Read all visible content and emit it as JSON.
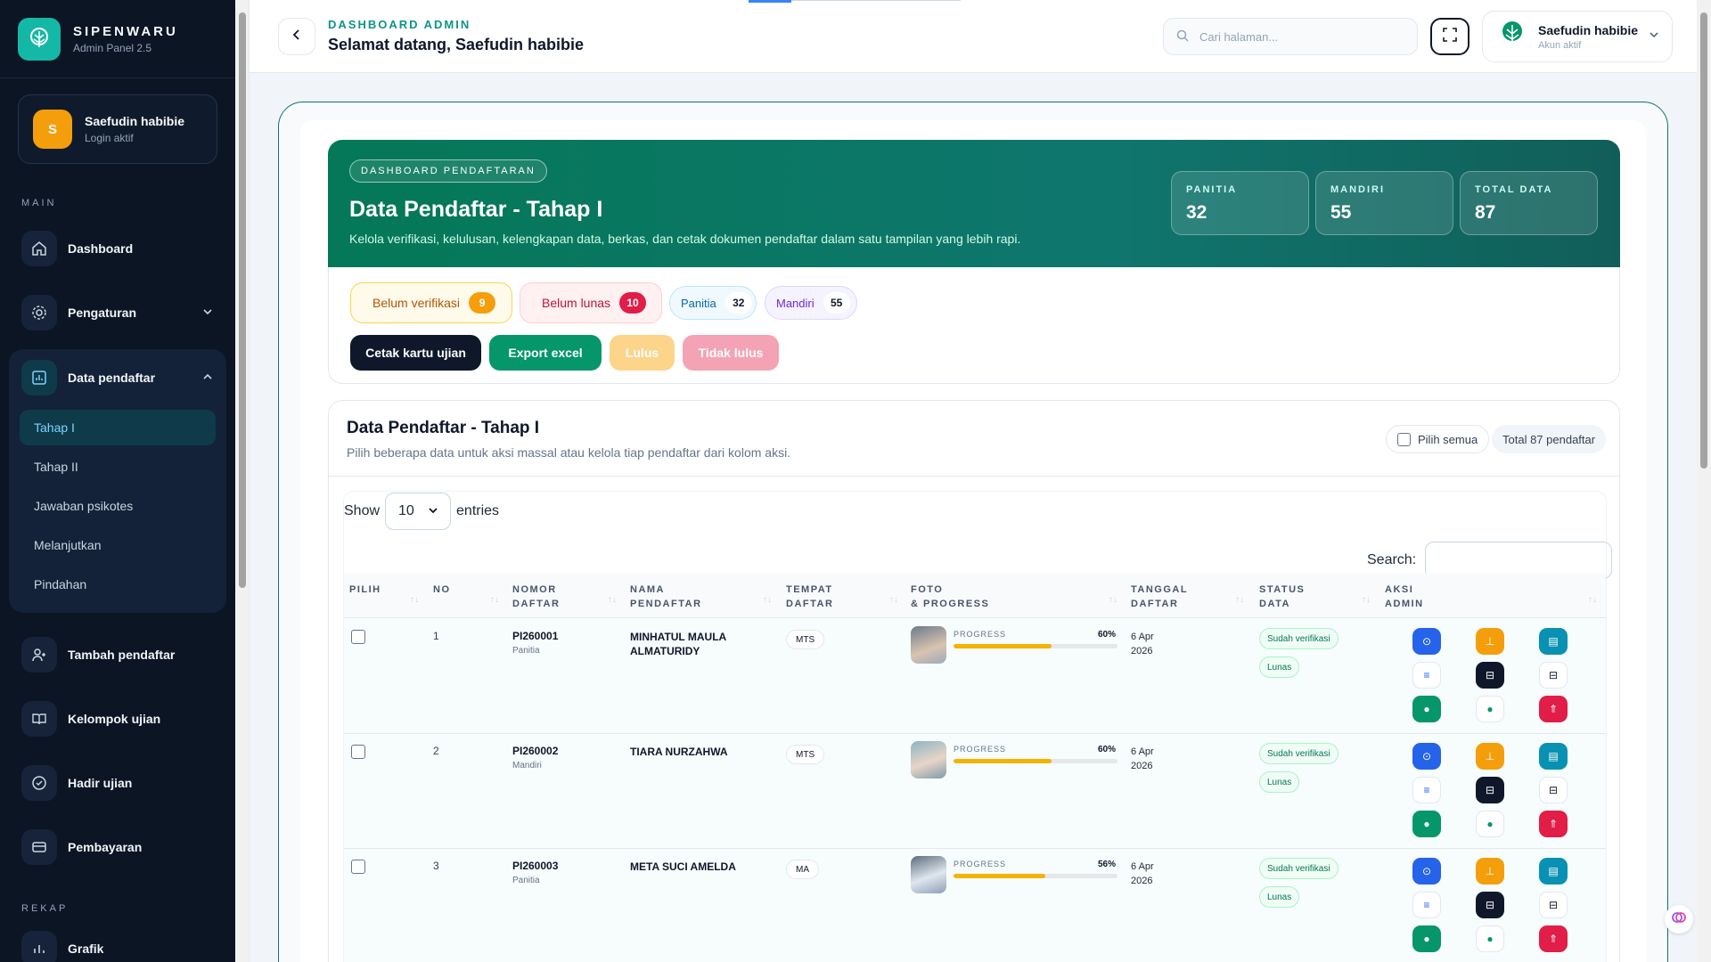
{
  "brand": {
    "name": "SIPENWARU",
    "sub": "Admin Panel 2.5"
  },
  "sidebar_user": {
    "initial": "S",
    "name": "Saefudin habibie",
    "status": "Login aktif"
  },
  "sidebar": {
    "section_main": "MAIN",
    "dashboard": "Dashboard",
    "pengaturan": "Pengaturan",
    "data_pendaftar": "Data pendaftar",
    "sub_items": [
      "Tahap I",
      "Tahap II",
      "Jawaban psikotes",
      "Melanjutkan",
      "Pindahan"
    ],
    "tambah": "Tambah pendaftar",
    "kelompok": "Kelompok ujian",
    "hadir": "Hadir ujian",
    "pembayaran": "Pembayaran",
    "section_rekap": "REKAP",
    "grafik": "Grafik"
  },
  "topbar": {
    "eyebrow": "DASHBOARD ADMIN",
    "title": "Selamat datang, Saefudin habibie",
    "search_placeholder": "Cari halaman...",
    "account_name": "Saefudin habibie",
    "account_status": "Akun aktif"
  },
  "hero": {
    "tag": "DASHBOARD PENDAFTARAN",
    "title": "Data Pendaftar - Tahap I",
    "desc": "Kelola verifikasi, kelulusan, kelengkapan data, berkas, dan cetak dokumen pendaftar dalam satu tampilan yang lebih rapi.",
    "stats": [
      {
        "label": "PANITIA",
        "value": "32"
      },
      {
        "label": "MANDIRI",
        "value": "55"
      },
      {
        "label": "TOTAL DATA",
        "value": "87"
      }
    ]
  },
  "filters": {
    "belum_verifikasi": {
      "label": "Belum verifikasi",
      "count": "9"
    },
    "belum_lunas": {
      "label": "Belum lunas",
      "count": "10"
    },
    "panitia": {
      "label": "Panitia",
      "count": "32"
    },
    "mandiri": {
      "label": "Mandiri",
      "count": "55"
    }
  },
  "actions": {
    "cetak": "Cetak kartu ujian",
    "export": "Export excel",
    "lulus": "Lulus",
    "tidak_lulus": "Tidak lulus"
  },
  "table_card": {
    "title": "Data Pendaftar - Tahap I",
    "desc": "Pilih beberapa data untuk aksi massal atau kelola tiap pendaftar dari kolom aksi.",
    "select_all": "Pilih semua",
    "total": "Total 87 pendaftar",
    "show": "Show",
    "entries_value": "10",
    "entries": "entries",
    "search": "Search:"
  },
  "columns": [
    {
      "l1": "PILIH",
      "l2": ""
    },
    {
      "l1": "NO",
      "l2": ""
    },
    {
      "l1": "NOMOR",
      "l2": "DAFTAR"
    },
    {
      "l1": "NAMA",
      "l2": "PENDAFTAR"
    },
    {
      "l1": "TEMPAT",
      "l2": "DAFTAR"
    },
    {
      "l1": "FOTO",
      "l2": "& PROGRESS"
    },
    {
      "l1": "TANGGAL",
      "l2": "DAFTAR"
    },
    {
      "l1": "STATUS",
      "l2": "DATA"
    },
    {
      "l1": "AKSI",
      "l2": "ADMIN"
    }
  ],
  "rows": [
    {
      "no": "1",
      "nomor": "PI260001",
      "jalur": "Panitia",
      "nama": "MINHATUL MAULA ALMATURIDY",
      "tempat": "MTS",
      "progress_label": "PROGRESS",
      "progress_text": "60%",
      "progress": 0.6,
      "tgl1": "6 Apr",
      "tgl2": "2026",
      "status1": "Sudah verifikasi",
      "status2": "Lunas"
    },
    {
      "no": "2",
      "nomor": "PI260002",
      "jalur": "Mandiri",
      "nama": "TIARA NURZAHWA",
      "tempat": "MTS",
      "progress_label": "PROGRESS",
      "progress_text": "60%",
      "progress": 0.6,
      "tgl1": "6 Apr",
      "tgl2": "2026",
      "status1": "Sudah verifikasi",
      "status2": "Lunas"
    },
    {
      "no": "3",
      "nomor": "PI260003",
      "jalur": "Panitia",
      "nama": "META SUCI AMELDA",
      "tempat": "MA",
      "progress_label": "PROGRESS",
      "progress_text": "56%",
      "progress": 0.56,
      "tgl1": "6 Apr",
      "tgl2": "2026",
      "status1": "Sudah verifikasi",
      "status2": "Lunas"
    }
  ],
  "colors": {
    "teal": "#0f766e",
    "accent": "#14b8a6",
    "amber": "#f59e0b",
    "red": "#e11d48",
    "blue": "#2563eb",
    "green": "#059669",
    "dark": "#0f172a"
  }
}
